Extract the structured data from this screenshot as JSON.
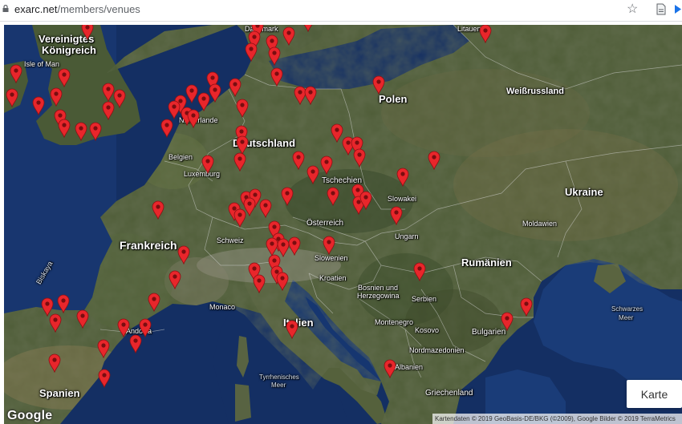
{
  "browser": {
    "url_host": "exarc.net",
    "url_path": "/members/venues",
    "icons": {
      "lock": "lock-icon",
      "bookmark": "star-icon",
      "document": "document-icon",
      "extension": "extension-icon"
    }
  },
  "map": {
    "labels": {
      "vereinigtes": "Vereinigtes",
      "koenigreich": "Königreich",
      "isle_of_man": "Isle of Man",
      "daenemark": "Dänemark",
      "litauen": "Litauen",
      "weissrussland": "Weißrussland",
      "polen": "Polen",
      "niederlande": "Niederlande",
      "deutschland": "Deutschland",
      "belgien": "Belgien",
      "luxemburg": "Luxemburg",
      "tschechien": "Tschechien",
      "slowakei": "Slowakei",
      "ukraine": "Ukraine",
      "frankreich": "Frankreich",
      "oesterreich": "Österreich",
      "moldawien": "Moldawien",
      "schweiz": "Schweiz",
      "ungarn": "Ungarn",
      "biskaya": "Biskaya",
      "slowenien": "Slowenien",
      "rumaenien": "Rumänien",
      "kroatien": "Kroatien",
      "bosnien": "Bosnien und",
      "herzegowina": "Herzegowina",
      "serbien": "Serbien",
      "monaco": "Monaco",
      "schwarzes": "Schwarzes",
      "meer": "Meer",
      "montenegro": "Montenegro",
      "italien": "Italien",
      "kosovo": "Kosovo",
      "bulgarien": "Bulgarien",
      "andorra": "Andorra",
      "nordmazedonien": "Nordmazedonien",
      "tyrrhenisches": "Tyrrhenisches",
      "tyrrhenisches_meer": "Meer",
      "albanien": "Albanien",
      "spanien": "Spanien",
      "griechenland": "Griechenland"
    },
    "marker_color": "#e8262b",
    "marker_icon": "map-pin-icon",
    "logo": "Google",
    "map_type_button": "Karte",
    "attribution": "Kartendaten © 2019 GeoBasis-DE/BKG (©2009), Google Bilder © 2019 TerraMetrics"
  },
  "colors": {
    "sea": "#13336b",
    "land": "#4e5c37",
    "forest": "#3a4a2a",
    "mountain": "#8a8878"
  }
}
